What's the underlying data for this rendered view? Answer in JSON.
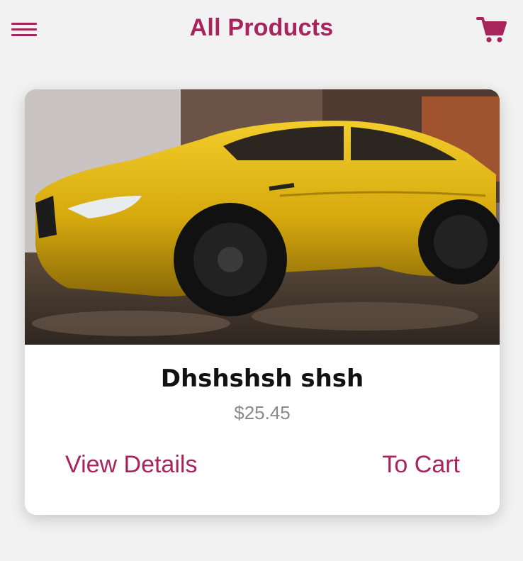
{
  "header": {
    "title": "All Products",
    "menu_icon": "hamburger-menu-icon",
    "cart_icon": "shopping-cart-icon"
  },
  "product": {
    "name": "Dhshshsh shsh",
    "price": "$25.45",
    "image_description_icon": "yellow-sports-car-photo",
    "view_details_label": "View Details",
    "to_cart_label": "To Cart"
  },
  "colors": {
    "accent": "#a8245d",
    "background": "#f2f2f2",
    "card": "#ffffff",
    "price_text": "#8a8a8a"
  }
}
